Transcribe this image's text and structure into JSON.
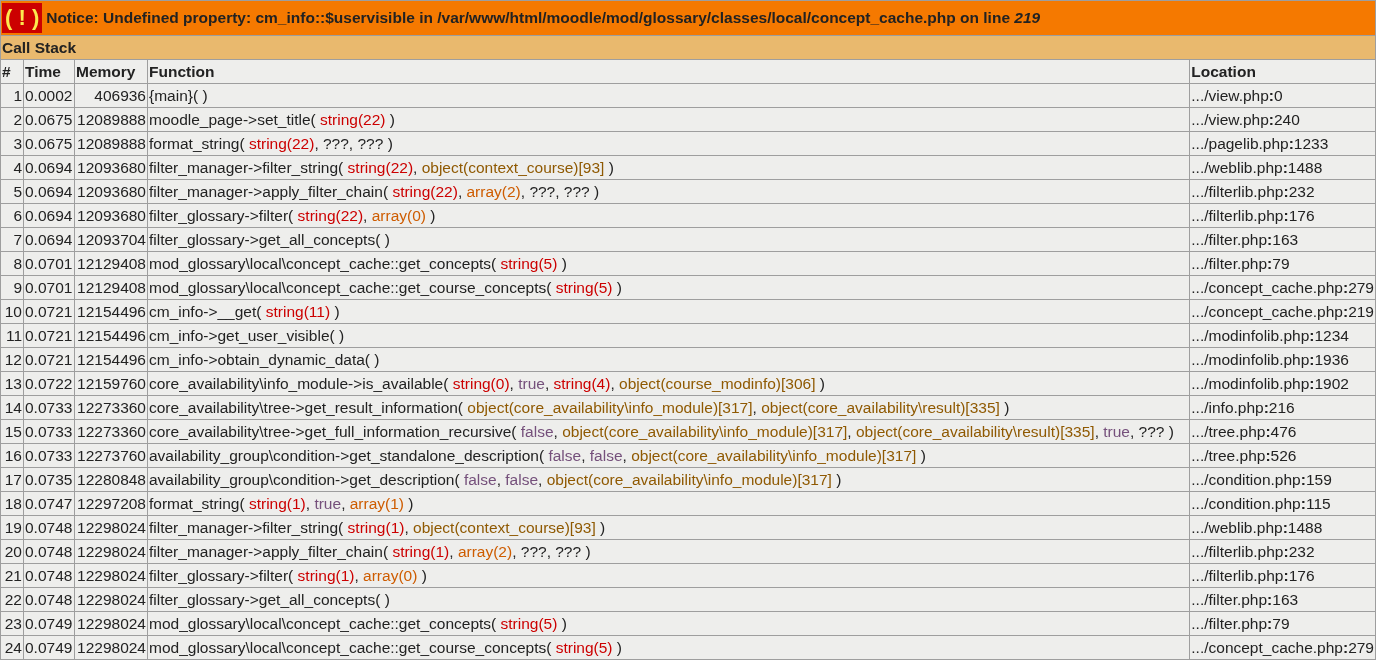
{
  "notice": {
    "badge": "( ! )",
    "message": "Notice: Undefined property: cm_info::$uservisible in /var/www/html/moodle/mod/glossary/classes/local/concept_cache.php on line *219*"
  },
  "call_stack": {
    "title": "Call Stack",
    "columns": [
      "#",
      "Time",
      "Memory",
      "Function",
      "Location"
    ],
    "rows": [
      {
        "index": "1",
        "time": "0.0002",
        "memory": "406936",
        "function": [
          {
            "kind": "plain",
            "text": "{main}( )"
          }
        ],
        "location": ".../view.php**:**0"
      },
      {
        "index": "2",
        "time": "0.0675",
        "memory": "12089888",
        "function": [
          {
            "kind": "plain",
            "text": "moodle_page->set_title( "
          },
          {
            "kind": "string",
            "text": "string(22)"
          },
          {
            "kind": "plain",
            "text": " )"
          }
        ],
        "location": ".../view.php**:**240"
      },
      {
        "index": "3",
        "time": "0.0675",
        "memory": "12089888",
        "function": [
          {
            "kind": "plain",
            "text": "format_string( "
          },
          {
            "kind": "string",
            "text": "string(22)"
          },
          {
            "kind": "plain",
            "text": ", ???, ??? )"
          }
        ],
        "location": ".../pagelib.php**:**1233"
      },
      {
        "index": "4",
        "time": "0.0694",
        "memory": "12093680",
        "function": [
          {
            "kind": "plain",
            "text": "filter_manager->filter_string( "
          },
          {
            "kind": "string",
            "text": "string(22)"
          },
          {
            "kind": "plain",
            "text": ", "
          },
          {
            "kind": "object",
            "text": "object(context_course)[93]"
          },
          {
            "kind": "plain",
            "text": " )"
          }
        ],
        "location": ".../weblib.php**:**1488"
      },
      {
        "index": "5",
        "time": "0.0694",
        "memory": "12093680",
        "function": [
          {
            "kind": "plain",
            "text": "filter_manager->apply_filter_chain( "
          },
          {
            "kind": "string",
            "text": "string(22)"
          },
          {
            "kind": "plain",
            "text": ", "
          },
          {
            "kind": "array",
            "text": "array(2)"
          },
          {
            "kind": "plain",
            "text": ", ???, ??? )"
          }
        ],
        "location": ".../filterlib.php**:**232"
      },
      {
        "index": "6",
        "time": "0.0694",
        "memory": "12093680",
        "function": [
          {
            "kind": "plain",
            "text": "filter_glossary->filter( "
          },
          {
            "kind": "string",
            "text": "string(22)"
          },
          {
            "kind": "plain",
            "text": ", "
          },
          {
            "kind": "array",
            "text": "array(0)"
          },
          {
            "kind": "plain",
            "text": " )"
          }
        ],
        "location": ".../filterlib.php**:**176"
      },
      {
        "index": "7",
        "time": "0.0694",
        "memory": "12093704",
        "function": [
          {
            "kind": "plain",
            "text": "filter_glossary->get_all_concepts( )"
          }
        ],
        "location": ".../filter.php**:**163"
      },
      {
        "index": "8",
        "time": "0.0701",
        "memory": "12129408",
        "function": [
          {
            "kind": "plain",
            "text": "mod_glossary\\local\\concept_cache::get_concepts( "
          },
          {
            "kind": "string",
            "text": "string(5)"
          },
          {
            "kind": "plain",
            "text": " )"
          }
        ],
        "location": ".../filter.php**:**79"
      },
      {
        "index": "9",
        "time": "0.0701",
        "memory": "12129408",
        "function": [
          {
            "kind": "plain",
            "text": "mod_glossary\\local\\concept_cache::get_course_concepts( "
          },
          {
            "kind": "string",
            "text": "string(5)"
          },
          {
            "kind": "plain",
            "text": " )"
          }
        ],
        "location": ".../concept_cache.php**:**279"
      },
      {
        "index": "10",
        "time": "0.0721",
        "memory": "12154496",
        "function": [
          {
            "kind": "plain",
            "text": "cm_info->__get( "
          },
          {
            "kind": "string",
            "text": "string(11)"
          },
          {
            "kind": "plain",
            "text": " )"
          }
        ],
        "location": ".../concept_cache.php**:**219"
      },
      {
        "index": "11",
        "time": "0.0721",
        "memory": "12154496",
        "function": [
          {
            "kind": "plain",
            "text": "cm_info->get_user_visible( )"
          }
        ],
        "location": ".../modinfolib.php**:**1234"
      },
      {
        "index": "12",
        "time": "0.0721",
        "memory": "12154496",
        "function": [
          {
            "kind": "plain",
            "text": "cm_info->obtain_dynamic_data( )"
          }
        ],
        "location": ".../modinfolib.php**:**1936"
      },
      {
        "index": "13",
        "time": "0.0722",
        "memory": "12159760",
        "function": [
          {
            "kind": "plain",
            "text": "core_availability\\info_module->is_available( "
          },
          {
            "kind": "string",
            "text": "string(0)"
          },
          {
            "kind": "plain",
            "text": ", "
          },
          {
            "kind": "bool",
            "text": "true"
          },
          {
            "kind": "plain",
            "text": ", "
          },
          {
            "kind": "string",
            "text": "string(4)"
          },
          {
            "kind": "plain",
            "text": ", "
          },
          {
            "kind": "object",
            "text": "object(course_modinfo)[306]"
          },
          {
            "kind": "plain",
            "text": " )"
          }
        ],
        "location": ".../modinfolib.php**:**1902"
      },
      {
        "index": "14",
        "time": "0.0733",
        "memory": "12273360",
        "function": [
          {
            "kind": "plain",
            "text": "core_availability\\tree->get_result_information( "
          },
          {
            "kind": "object",
            "text": "object(core_availability\\info_module)[317]"
          },
          {
            "kind": "plain",
            "text": ", "
          },
          {
            "kind": "object",
            "text": "object(core_availability\\result)[335]"
          },
          {
            "kind": "plain",
            "text": " )"
          }
        ],
        "location": ".../info.php**:**216"
      },
      {
        "index": "15",
        "time": "0.0733",
        "memory": "12273360",
        "function": [
          {
            "kind": "plain",
            "text": "core_availability\\tree->get_full_information_recursive( "
          },
          {
            "kind": "bool",
            "text": "false"
          },
          {
            "kind": "plain",
            "text": ", "
          },
          {
            "kind": "object",
            "text": "object(core_availability\\info_module)[317]"
          },
          {
            "kind": "plain",
            "text": ", "
          },
          {
            "kind": "object",
            "text": "object(core_availability\\result)[335]"
          },
          {
            "kind": "plain",
            "text": ", "
          },
          {
            "kind": "bool",
            "text": "true"
          },
          {
            "kind": "plain",
            "text": ", ??? )"
          }
        ],
        "location": ".../tree.php**:**476"
      },
      {
        "index": "16",
        "time": "0.0733",
        "memory": "12273760",
        "function": [
          {
            "kind": "plain",
            "text": "availability_group\\condition->get_standalone_description( "
          },
          {
            "kind": "bool",
            "text": "false"
          },
          {
            "kind": "plain",
            "text": ", "
          },
          {
            "kind": "bool",
            "text": "false"
          },
          {
            "kind": "plain",
            "text": ", "
          },
          {
            "kind": "object",
            "text": "object(core_availability\\info_module)[317]"
          },
          {
            "kind": "plain",
            "text": " )"
          }
        ],
        "location": ".../tree.php**:**526"
      },
      {
        "index": "17",
        "time": "0.0735",
        "memory": "12280848",
        "function": [
          {
            "kind": "plain",
            "text": "availability_group\\condition->get_description( "
          },
          {
            "kind": "bool",
            "text": "false"
          },
          {
            "kind": "plain",
            "text": ", "
          },
          {
            "kind": "bool",
            "text": "false"
          },
          {
            "kind": "plain",
            "text": ", "
          },
          {
            "kind": "object",
            "text": "object(core_availability\\info_module)[317]"
          },
          {
            "kind": "plain",
            "text": " )"
          }
        ],
        "location": ".../condition.php**:**159"
      },
      {
        "index": "18",
        "time": "0.0747",
        "memory": "12297208",
        "function": [
          {
            "kind": "plain",
            "text": "format_string( "
          },
          {
            "kind": "string",
            "text": "string(1)"
          },
          {
            "kind": "plain",
            "text": ", "
          },
          {
            "kind": "bool",
            "text": "true"
          },
          {
            "kind": "plain",
            "text": ", "
          },
          {
            "kind": "array",
            "text": "array(1)"
          },
          {
            "kind": "plain",
            "text": " )"
          }
        ],
        "location": ".../condition.php**:**115"
      },
      {
        "index": "19",
        "time": "0.0748",
        "memory": "12298024",
        "function": [
          {
            "kind": "plain",
            "text": "filter_manager->filter_string( "
          },
          {
            "kind": "string",
            "text": "string(1)"
          },
          {
            "kind": "plain",
            "text": ", "
          },
          {
            "kind": "object",
            "text": "object(context_course)[93]"
          },
          {
            "kind": "plain",
            "text": " )"
          }
        ],
        "location": ".../weblib.php**:**1488"
      },
      {
        "index": "20",
        "time": "0.0748",
        "memory": "12298024",
        "function": [
          {
            "kind": "plain",
            "text": "filter_manager->apply_filter_chain( "
          },
          {
            "kind": "string",
            "text": "string(1)"
          },
          {
            "kind": "plain",
            "text": ", "
          },
          {
            "kind": "array",
            "text": "array(2)"
          },
          {
            "kind": "plain",
            "text": ", ???, ??? )"
          }
        ],
        "location": ".../filterlib.php**:**232"
      },
      {
        "index": "21",
        "time": "0.0748",
        "memory": "12298024",
        "function": [
          {
            "kind": "plain",
            "text": "filter_glossary->filter( "
          },
          {
            "kind": "string",
            "text": "string(1)"
          },
          {
            "kind": "plain",
            "text": ", "
          },
          {
            "kind": "array",
            "text": "array(0)"
          },
          {
            "kind": "plain",
            "text": " )"
          }
        ],
        "location": ".../filterlib.php**:**176"
      },
      {
        "index": "22",
        "time": "0.0748",
        "memory": "12298024",
        "function": [
          {
            "kind": "plain",
            "text": "filter_glossary->get_all_concepts( )"
          }
        ],
        "location": ".../filter.php**:**163"
      },
      {
        "index": "23",
        "time": "0.0749",
        "memory": "12298024",
        "function": [
          {
            "kind": "plain",
            "text": "mod_glossary\\local\\concept_cache::get_concepts( "
          },
          {
            "kind": "string",
            "text": "string(5)"
          },
          {
            "kind": "plain",
            "text": " )"
          }
        ],
        "location": ".../filter.php**:**79"
      },
      {
        "index": "24",
        "time": "0.0749",
        "memory": "12298024",
        "function": [
          {
            "kind": "plain",
            "text": "mod_glossary\\local\\concept_cache::get_course_concepts( "
          },
          {
            "kind": "string",
            "text": "string(5)"
          },
          {
            "kind": "plain",
            "text": " )"
          }
        ],
        "location": ".../concept_cache.php**:**279"
      }
    ]
  }
}
